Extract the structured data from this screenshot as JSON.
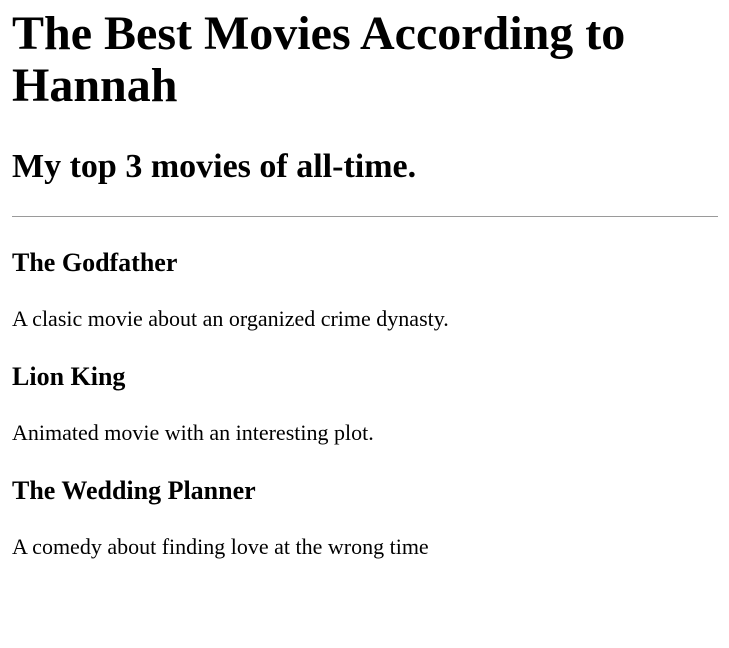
{
  "header": {
    "title": "The Best Movies According to Hannah",
    "subtitle": "My top 3 movies of all-time."
  },
  "movies": [
    {
      "title": "The Godfather",
      "description": "A clasic movie about an organized crime dynasty."
    },
    {
      "title": "Lion King",
      "description": "Animated movie with an interesting plot."
    },
    {
      "title": "The Wedding Planner",
      "description": "A comedy about finding love at the wrong time"
    }
  ]
}
